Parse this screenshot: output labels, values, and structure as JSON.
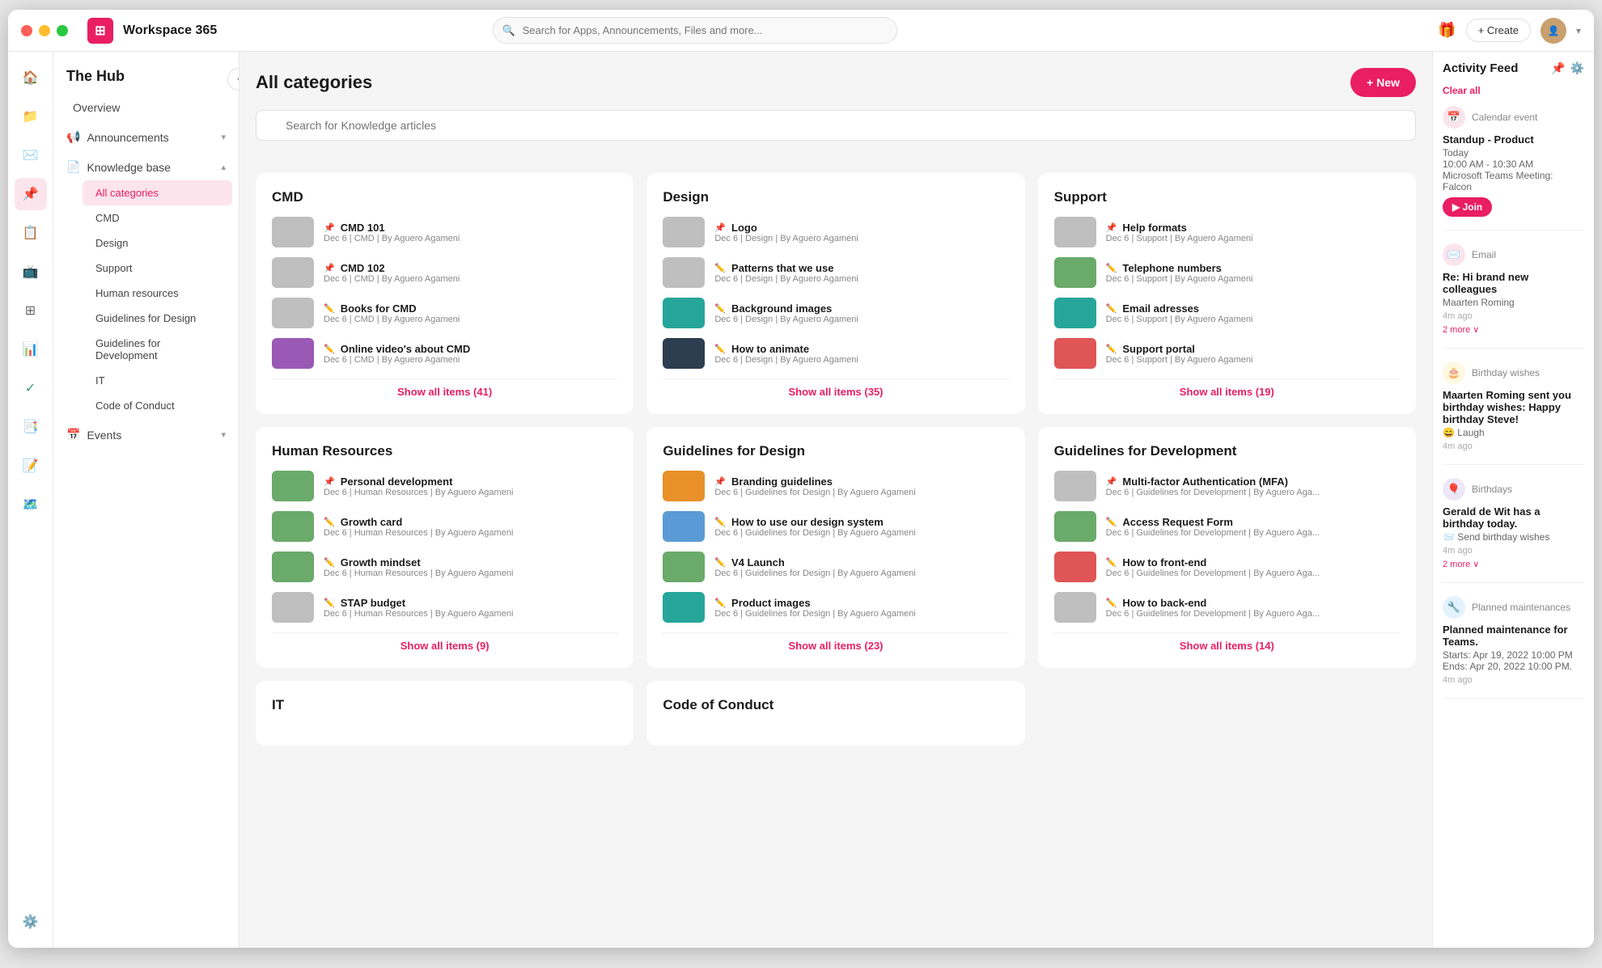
{
  "window": {
    "title": "Workspace 365"
  },
  "titlebar": {
    "app_title": "Workspace 365",
    "search_placeholder": "Search for Apps, Announcements, Files and more...",
    "create_label": "+ Create"
  },
  "sidebar": {
    "section_title": "The Hub",
    "overview_label": "Overview",
    "announcements_label": "Announcements",
    "knowledge_base_label": "Knowledge base",
    "all_categories_label": "All categories",
    "cmd_label": "CMD",
    "design_label": "Design",
    "support_label": "Support",
    "human_resources_label": "Human resources",
    "guidelines_design_label": "Guidelines for Design",
    "guidelines_dev_label": "Guidelines for Development",
    "it_label": "IT",
    "code_of_conduct_label": "Code of Conduct",
    "events_label": "Events"
  },
  "content": {
    "title": "All categories",
    "new_label": "+ New",
    "search_placeholder": "Search for Knowledge articles",
    "categories": [
      {
        "id": "cmd",
        "title": "CMD",
        "articles": [
          {
            "title": "CMD 101",
            "meta": "Dec 6 | CMD | By Aguero Agameni",
            "pinned": true,
            "thumb": "gray"
          },
          {
            "title": "CMD 102",
            "meta": "Dec 6 | CMD | By Aguero Agameni",
            "pinned": true,
            "thumb": "gray"
          },
          {
            "title": "Books for CMD",
            "meta": "Dec 6 | CMD | By Aguero Agameni",
            "pinned": false,
            "thumb": "gray"
          },
          {
            "title": "Online video's about CMD",
            "meta": "Dec 6 | CMD | By Aguero Agameni",
            "pinned": false,
            "thumb": "purple"
          }
        ],
        "show_all": "Show all items (41)"
      },
      {
        "id": "design",
        "title": "Design",
        "articles": [
          {
            "title": "Logo",
            "meta": "Dec 6 | Design | By Aguero Agameni",
            "pinned": true,
            "thumb": "gray"
          },
          {
            "title": "Patterns that we use",
            "meta": "Dec 6 | Design | By Aguero Agameni",
            "pinned": false,
            "thumb": "gray"
          },
          {
            "title": "Background images",
            "meta": "Dec 6 | Design | By Aguero Agameni",
            "pinned": false,
            "thumb": "teal"
          },
          {
            "title": "How to animate",
            "meta": "Dec 6 | Design | By Aguero Agameni",
            "pinned": false,
            "thumb": "dark"
          }
        ],
        "show_all": "Show all items (35)"
      },
      {
        "id": "support",
        "title": "Support",
        "articles": [
          {
            "title": "Help formats",
            "meta": "Dec 6 | Support | By Aguero Agameni",
            "pinned": true,
            "thumb": "gray"
          },
          {
            "title": "Telephone numbers",
            "meta": "Dec 6 | Support | By Aguero Agameni",
            "pinned": false,
            "thumb": "green"
          },
          {
            "title": "Email adresses",
            "meta": "Dec 6 | Support | By Aguero Agameni",
            "pinned": false,
            "thumb": "teal"
          },
          {
            "title": "Support portal",
            "meta": "Dec 6 | Support | By Aguero Agameni",
            "pinned": false,
            "thumb": "red"
          }
        ],
        "show_all": "Show all items (19)"
      },
      {
        "id": "human-resources",
        "title": "Human Resources",
        "articles": [
          {
            "title": "Personal development",
            "meta": "Dec 6 | Human Resources | By Aguero Agameni",
            "pinned": true,
            "thumb": "green"
          },
          {
            "title": "Growth card",
            "meta": "Dec 6 | Human Resources | By Aguero Agameni",
            "pinned": false,
            "thumb": "green"
          },
          {
            "title": "Growth mindset",
            "meta": "Dec 6 | Human Resources | By Aguero Agameni",
            "pinned": false,
            "thumb": "green"
          },
          {
            "title": "STAP budget",
            "meta": "Dec 6 | Human Resources | By Aguero Agameni",
            "pinned": false,
            "thumb": "gray"
          }
        ],
        "show_all": "Show all items (9)"
      },
      {
        "id": "guidelines-design",
        "title": "Guidelines for Design",
        "articles": [
          {
            "title": "Branding guidelines",
            "meta": "Dec 6 | Guidelines for Design | By Aguero Agameni",
            "pinned": true,
            "thumb": "orange"
          },
          {
            "title": "How to use our design system",
            "meta": "Dec 6 | Guidelines for Design | By Aguero Agameni",
            "pinned": false,
            "thumb": "blue"
          },
          {
            "title": "V4 Launch",
            "meta": "Dec 6 | Guidelines for Design | By Aguero Agameni",
            "pinned": false,
            "thumb": "green"
          },
          {
            "title": "Product images",
            "meta": "Dec 6 | Guidelines for Design | By Aguero Agameni",
            "pinned": false,
            "thumb": "teal"
          }
        ],
        "show_all": "Show all items (23)"
      },
      {
        "id": "guidelines-dev",
        "title": "Guidelines for Development",
        "articles": [
          {
            "title": "Multi-factor Authentication (MFA)",
            "meta": "Dec 6 | Guidelines for Development | By Aguero Aga...",
            "pinned": true,
            "thumb": "gray"
          },
          {
            "title": "Access Request Form",
            "meta": "Dec 6 | Guidelines for Development | By Aguero Aga...",
            "pinned": false,
            "thumb": "green"
          },
          {
            "title": "How to front-end",
            "meta": "Dec 6 | Guidelines for Development | By Aguero Aga...",
            "pinned": false,
            "thumb": "red"
          },
          {
            "title": "How to back-end",
            "meta": "Dec 6 | Guidelines for Development | By Aguero Aga...",
            "pinned": false,
            "thumb": "gray"
          }
        ],
        "show_all": "Show all items (14)"
      },
      {
        "id": "it",
        "title": "IT",
        "articles": [],
        "show_all": ""
      },
      {
        "id": "code-of-conduct",
        "title": "Code of Conduct",
        "articles": [],
        "show_all": ""
      }
    ]
  },
  "activity_feed": {
    "title": "Activity Feed",
    "clear_all": "Clear all",
    "items": [
      {
        "type": "Calendar event",
        "icon": "📅",
        "dot_class": "feed-dot-red",
        "title": "Standup - Product",
        "sub1": "Today",
        "sub2": "10:00 AM - 10:30 AM",
        "sub3": "Microsoft Teams Meeting: Falcon",
        "time": "",
        "action": "Join"
      },
      {
        "type": "Email",
        "icon": "✉️",
        "dot_class": "feed-dot-red",
        "title": "Re: Hi brand new colleagues",
        "sub1": "Maarten Roming",
        "sub2": "",
        "sub3": "",
        "time": "4m ago",
        "action": "",
        "more": "2 more ∨"
      },
      {
        "type": "Birthday wishes",
        "icon": "🎂",
        "dot_class": "feed-dot-yellow",
        "title": "Maarten Roming sent you birthday wishes: Happy birthday Steve!",
        "sub1": "",
        "sub2": "😄 Laugh",
        "sub3": "",
        "time": "4m ago",
        "action": ""
      },
      {
        "type": "Birthdays",
        "icon": "🎈",
        "dot_class": "feed-dot-purple",
        "title": "Gerald de Wit has a birthday today.",
        "sub1": "",
        "sub2": "📨 Send birthday wishes",
        "sub3": "",
        "time": "4m ago",
        "action": "",
        "more": "2 more ∨"
      },
      {
        "type": "Planned maintenances",
        "icon": "🔧",
        "dot_class": "feed-dot-blue",
        "title": "Planned maintenance for Teams.",
        "sub1": "Starts: Apr 19, 2022 10:00 PM",
        "sub2": "Ends: Apr 20, 2022 10:00 PM.",
        "sub3": "",
        "time": "4m ago",
        "action": ""
      }
    ]
  },
  "icons": {
    "search": "🔍",
    "gift": "🎁",
    "pin": "📌",
    "pencil": "✏️"
  }
}
